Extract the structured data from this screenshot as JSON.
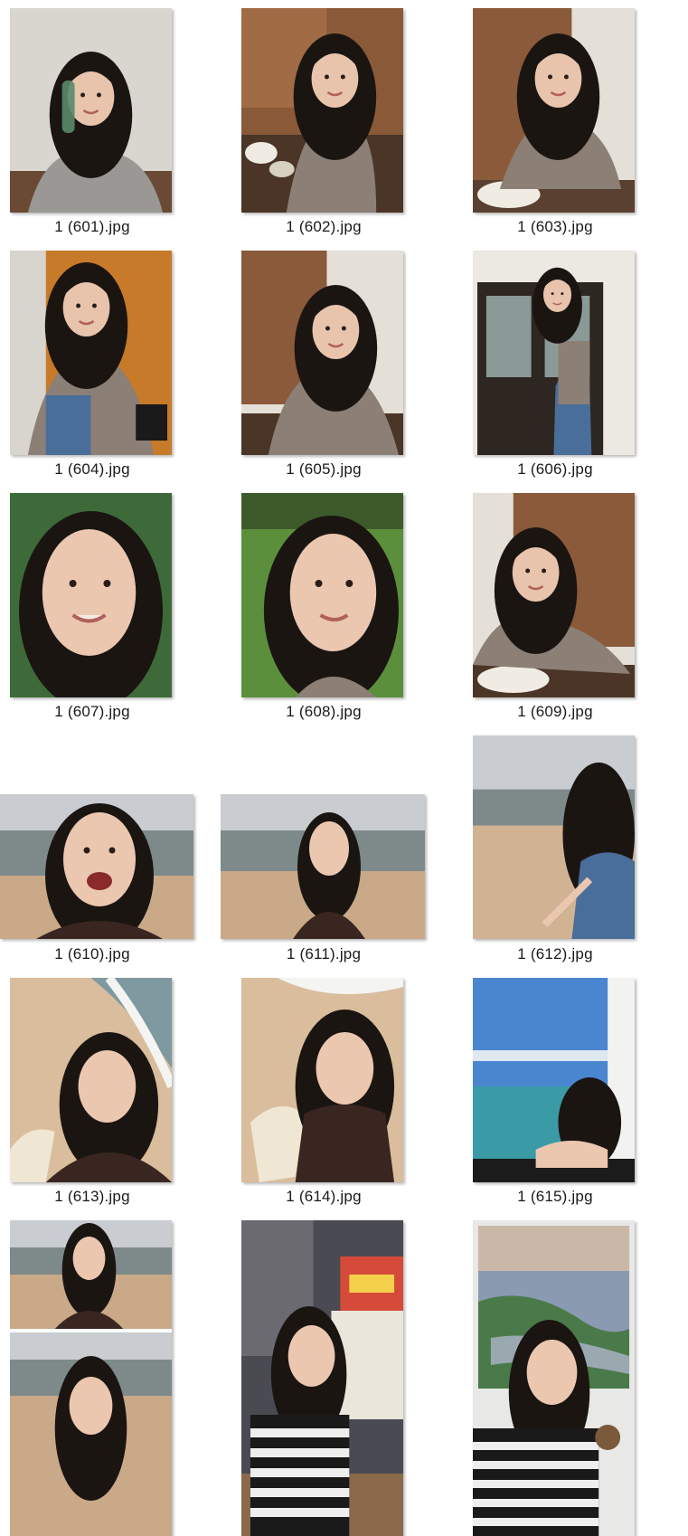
{
  "files": [
    {
      "name": "1 (601).jpg",
      "scene": "indoor-selfie-bottle"
    },
    {
      "name": "1 (602).jpg",
      "scene": "cafe-table-overhead"
    },
    {
      "name": "1 (603).jpg",
      "scene": "cafe-cabinet-profile"
    },
    {
      "name": "1 (604).jpg",
      "scene": "sitting-floor-selfie"
    },
    {
      "name": "1 (605).jpg",
      "scene": "cafe-cabinet-smile"
    },
    {
      "name": "1 (606).jpg",
      "scene": "doorway-standing"
    },
    {
      "name": "1 (607).jpg",
      "scene": "closeup-greenery"
    },
    {
      "name": "1 (608).jpg",
      "scene": "closeup-lawn"
    },
    {
      "name": "1 (609).jpg",
      "scene": "cafe-leaning-table"
    },
    {
      "name": "1 (610).jpg",
      "scene": "beach-laughing"
    },
    {
      "name": "1 (611).jpg",
      "scene": "beach-wide"
    },
    {
      "name": "1 (612).jpg",
      "scene": "beach-crouching"
    },
    {
      "name": "1 (613).jpg",
      "scene": "beach-overhead-waves"
    },
    {
      "name": "1 (614).jpg",
      "scene": "beach-overhead-sand"
    },
    {
      "name": "1 (615).jpg",
      "scene": "balcony-sea-view"
    },
    {
      "name": "",
      "scene": "beach-double-portrait"
    },
    {
      "name": "",
      "scene": "street-market-night"
    },
    {
      "name": "",
      "scene": "window-river-view"
    }
  ]
}
